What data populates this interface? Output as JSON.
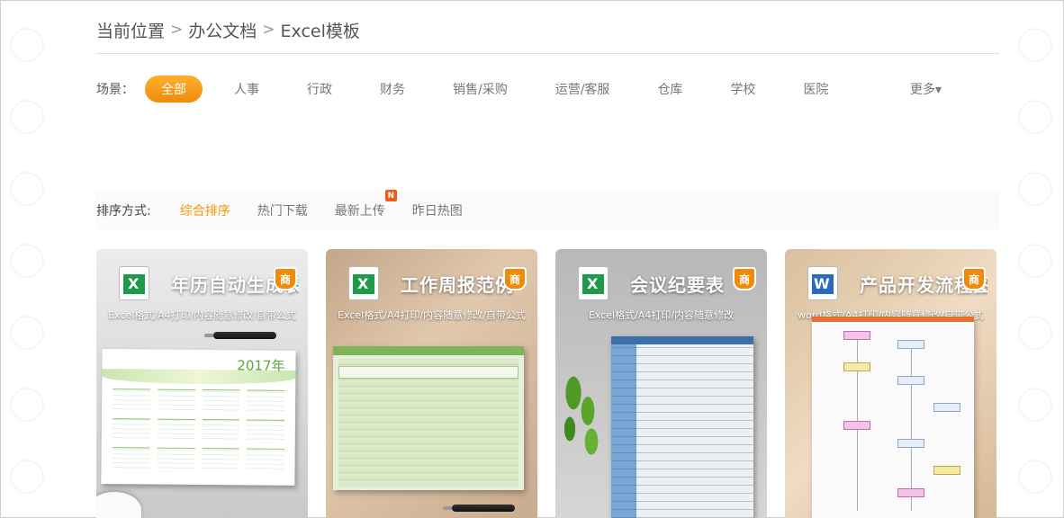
{
  "breadcrumb": {
    "items": [
      "当前位置",
      "办公文档",
      "Excel模板"
    ],
    "separator": ">"
  },
  "scene": {
    "label": "场景：",
    "items": [
      "全部",
      "人事",
      "行政",
      "财务",
      "销售/采购",
      "运营/客服",
      "仓库",
      "学校",
      "医院"
    ],
    "active_index": 0,
    "more": "更多▾"
  },
  "sort": {
    "label": "排序方式:",
    "items": [
      "综合排序",
      "热门下载",
      "最新上传",
      "昨日热图"
    ],
    "active_index": 0,
    "new_badge": "N"
  },
  "cards": [
    {
      "title": "年历自动生成表",
      "subtitle": "Excel格式/A4打印/内容随意修改/自带公式",
      "badge": "商",
      "icon": "excel-icon",
      "year": "2017年"
    },
    {
      "title": "工作周报范例",
      "subtitle": "Excel格式/A4打印/内容随意修改/自带公式",
      "badge": "商",
      "icon": "excel-icon"
    },
    {
      "title": "会议纪要表",
      "subtitle": "Excel格式/A4打印/内容随意修改",
      "badge": "商",
      "icon": "excel-icon"
    },
    {
      "title": "产品开发流程图",
      "subtitle": "word格式/A4打印/内容随意修改/自带公式",
      "badge": "商",
      "icon": "word-icon"
    }
  ],
  "colors": {
    "accent": "#f39800",
    "new_badge": "#f25a1b",
    "excel_green": "#1f9a4a"
  }
}
